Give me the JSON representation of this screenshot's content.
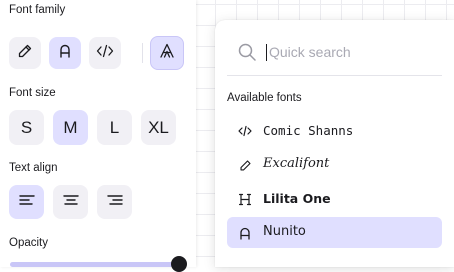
{
  "panel": {
    "font_family": {
      "label": "Font family",
      "buttons": [
        {
          "icon": "pencil-icon",
          "active": false
        },
        {
          "icon": "font-normal-icon",
          "glyph": "A",
          "active": true
        },
        {
          "icon": "code-icon",
          "glyph": "</>",
          "active": false
        }
      ],
      "more_button": {
        "icon": "font-more-icon",
        "glyph": "A",
        "active": true
      }
    },
    "font_size": {
      "label": "Font size",
      "options": [
        "S",
        "M",
        "L",
        "XL"
      ],
      "selected": "M"
    },
    "text_align": {
      "label": "Text align",
      "options": [
        "left",
        "center",
        "right"
      ],
      "selected": "left"
    },
    "opacity": {
      "label": "Opacity",
      "value": 1.0
    }
  },
  "font_picker": {
    "search_placeholder": "Quick search",
    "search_value": "",
    "section_heading": "Available fonts",
    "fonts": [
      {
        "name": "Comic Shanns",
        "icon": "code-icon",
        "selected": false
      },
      {
        "name": "Excalifont",
        "icon": "pencil-icon",
        "selected": false
      },
      {
        "name": "Lilita One",
        "icon": "heading-icon",
        "selected": false
      },
      {
        "name": "Nunito",
        "icon": "font-normal-icon",
        "selected": true
      }
    ]
  },
  "colors": {
    "accent_bg": "#e0dfff",
    "button_bg": "#f1f0f5",
    "text": "#1b1b1f"
  }
}
